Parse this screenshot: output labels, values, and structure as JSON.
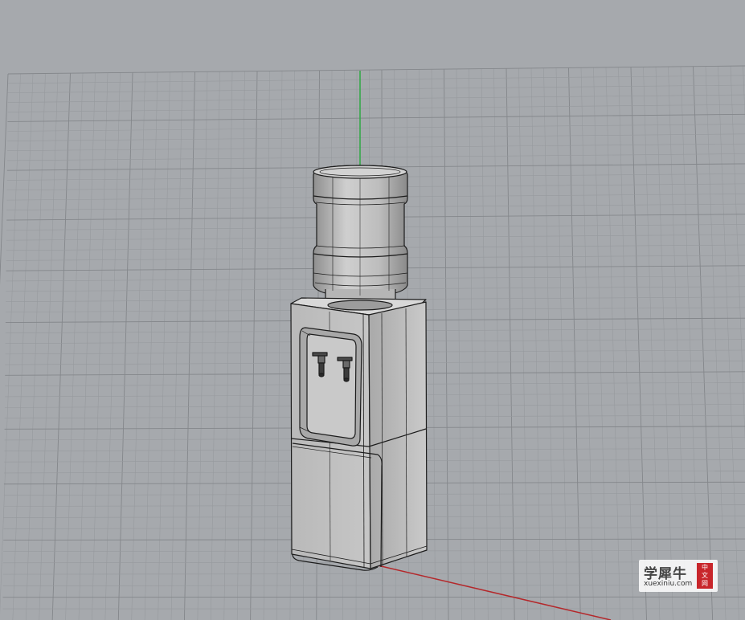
{
  "viewport": {
    "background": "#a6a9ad",
    "grid_minor_color": "#979a9e",
    "grid_major_color": "#84878b",
    "x_axis_color": "#b4282b",
    "y_axis_color": "#2fa844",
    "model_fill": "#bcbcbc",
    "model_edge": "#1c1c1c"
  },
  "watermark": {
    "brand": "学犀牛",
    "url": "xuexiniu.com",
    "seal_chars": [
      "中",
      "文",
      "网"
    ]
  }
}
